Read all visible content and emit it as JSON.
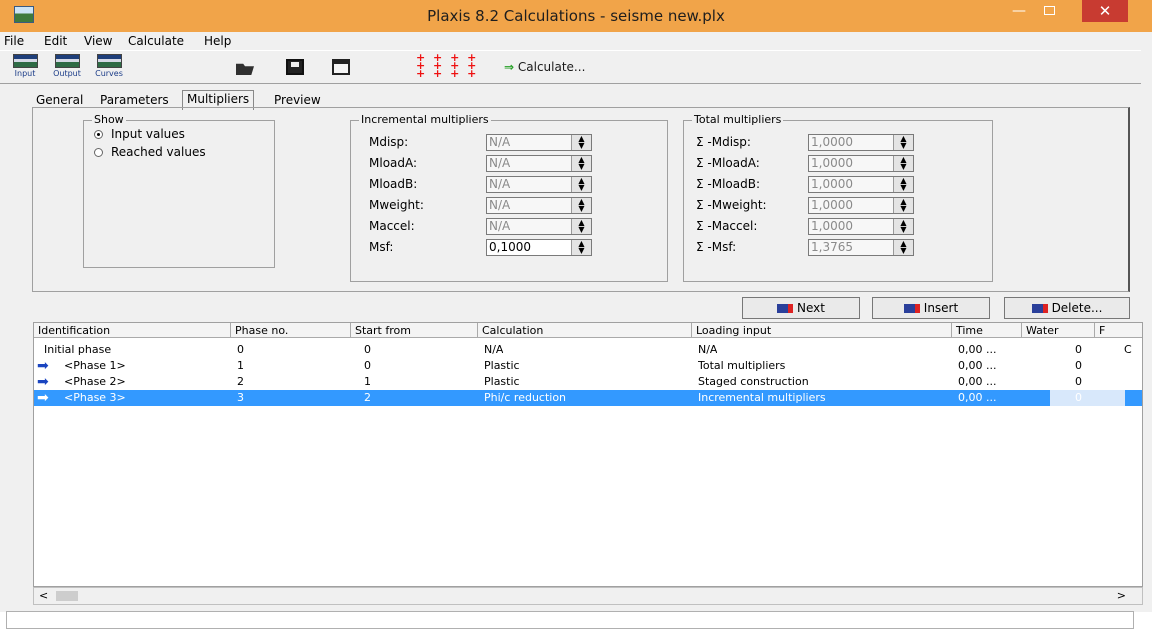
{
  "window": {
    "title": "Plaxis 8.2 Calculations - seisme new.plx",
    "minimize": "—",
    "close": "✕"
  },
  "menu": [
    "File",
    "Edit",
    "View",
    "Calculate",
    "Help"
  ],
  "toolbar": {
    "input_label": "Input",
    "output_label": "Output",
    "curves_label": "Curves",
    "points_glyphs": "+ + + +\n+ + + +\n+ + + +",
    "calculate_label": "Calculate..."
  },
  "tabs": [
    {
      "label": "General",
      "active": false
    },
    {
      "label": "Parameters",
      "active": false
    },
    {
      "label": "Multipliers",
      "active": true
    },
    {
      "label": "Preview",
      "active": false
    }
  ],
  "show_group": {
    "title": "Show",
    "options": [
      {
        "label": "Input values",
        "selected": true
      },
      {
        "label": "Reached values",
        "selected": false
      }
    ]
  },
  "incremental": {
    "title": "Incremental multipliers",
    "rows": [
      {
        "label": "Mdisp:",
        "value": "N/A"
      },
      {
        "label": "MloadA:",
        "value": "N/A"
      },
      {
        "label": "MloadB:",
        "value": "N/A"
      },
      {
        "label": "Mweight:",
        "value": "N/A"
      },
      {
        "label": "Maccel:",
        "value": "N/A"
      },
      {
        "label": "Msf:",
        "value": "0,1000"
      }
    ]
  },
  "total": {
    "title": "Total multipliers",
    "rows": [
      {
        "label": "Σ -Mdisp:",
        "value": "1,0000"
      },
      {
        "label": "Σ -MloadA:",
        "value": "1,0000"
      },
      {
        "label": "Σ -MloadB:",
        "value": "1,0000"
      },
      {
        "label": "Σ -Mweight:",
        "value": "1,0000"
      },
      {
        "label": "Σ -Maccel:",
        "value": "1,0000"
      },
      {
        "label": "Σ -Msf:",
        "value": "1,3765"
      }
    ]
  },
  "buttons": {
    "next": "Next",
    "insert": "Insert",
    "delete": "Delete..."
  },
  "table": {
    "columns": [
      "Identification",
      "Phase no.",
      "Start from",
      "Calculation",
      "Loading input",
      "Time",
      "Water",
      "F"
    ],
    "rows": [
      {
        "id": "Initial phase",
        "phase": "0",
        "start": "0",
        "calc": "N/A",
        "loading": "N/A",
        "time": "0,00 ...",
        "water": "0",
        "extra": "C",
        "arrow": "",
        "selected": false
      },
      {
        "id": "<Phase 1>",
        "phase": "1",
        "start": "0",
        "calc": "Plastic",
        "loading": "Total multipliers",
        "time": "0,00 ...",
        "water": "0",
        "extra": "",
        "arrow": "➡",
        "selected": false
      },
      {
        "id": "<Phase 2>",
        "phase": "2",
        "start": "1",
        "calc": "Plastic",
        "loading": "Staged construction",
        "time": "0,00 ...",
        "water": "0",
        "extra": "",
        "arrow": "➡",
        "selected": false
      },
      {
        "id": "<Phase 3>",
        "phase": "3",
        "start": "2",
        "calc": "Phi/c reduction",
        "loading": "Incremental multipliers",
        "time": "0,00 ...",
        "water": "0",
        "extra": "",
        "arrow": "➡",
        "selected": true
      }
    ]
  },
  "scroll": {
    "left": "<",
    "right": ">"
  },
  "colors": {
    "titlebar": "#f1a449",
    "selection": "#3399ff",
    "close": "#c83b31"
  }
}
